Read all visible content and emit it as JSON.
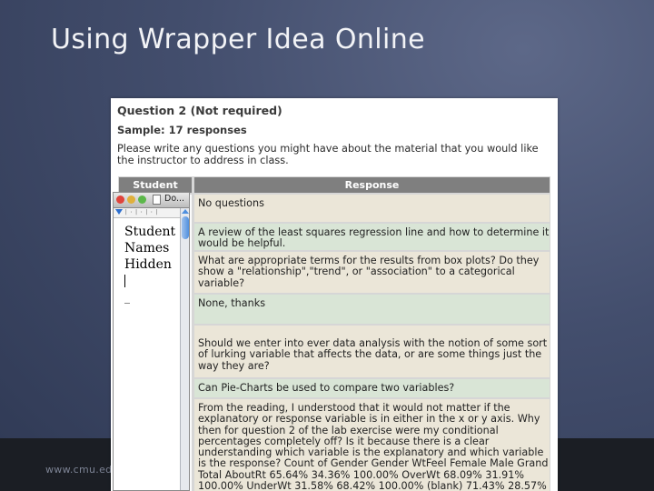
{
  "slide": {
    "title": "Using Wrapper Idea Online",
    "footer_url": "www.cmu.edu/"
  },
  "survey": {
    "question_title": "Question 2 (Not required)",
    "sample": "Sample: 17 responses",
    "prompt": "Please write any questions you might have about the material that you would like the instructor to address in class.",
    "columns": {
      "student": "Student",
      "response": "Response"
    },
    "responses": [
      "No questions",
      "A review of the least squares regression line and how to determine it would be helpful.",
      "What are appropriate terms for the results from box plots? Do they show a \"relationship\",\"trend\", or \"association\" to a categorical variable?",
      "None, thanks",
      "Should we enter into ever data analysis with the notion of some sort of lurking variable that affects the data, or are some things just the way they are?",
      "Can Pie-Charts be used to compare two variables?",
      "From the reading, I understood that it would not matter if the explanatory or response variable is in either in the x or y axis. Why then for question 2 of the lab exercise were my conditional percentages completely off? Is it because there is a clear understanding which variable is the explanatory and which variable is the response? Count of Gender Gender WtFeel Female Male Grand Total AboutRt 65.64% 34.36% 100.00% OverWt 68.09% 31.91% 100.00% UnderWt 31.58% 68.42% 100.00% (blank) 71.43% 28.57%"
    ]
  },
  "popup": {
    "title": "Do...",
    "text_lines": [
      "Student",
      "Names",
      "Hidden"
    ]
  }
}
